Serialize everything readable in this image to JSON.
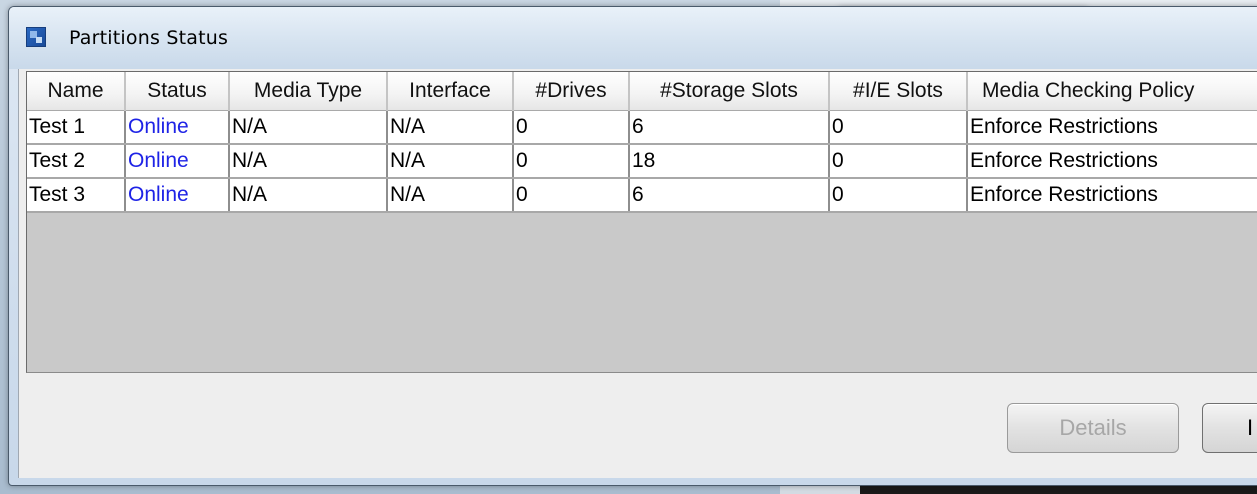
{
  "window": {
    "title": "Partitions Status"
  },
  "table": {
    "columns": [
      "Name",
      "Status",
      "Media Type",
      "Interface",
      "#Drives",
      "#Storage Slots",
      "#I/E Slots",
      "Media Checking Policy"
    ],
    "rows": [
      [
        "Test 1",
        "Online",
        "N/A",
        "N/A",
        "0",
        "6",
        "0",
        "Enforce Restrictions"
      ],
      [
        "Test 2",
        "Online",
        "N/A",
        "N/A",
        "0",
        "18",
        "0",
        "Enforce Restrictions"
      ],
      [
        "Test 3",
        "Online",
        "N/A",
        "N/A",
        "0",
        "6",
        "0",
        "Enforce Restrictions"
      ]
    ]
  },
  "buttons": {
    "details": "Details",
    "next_partial": "I"
  },
  "colors": {
    "status_online": "#1e23e6",
    "disabled_text": "#a7a7a7"
  },
  "icons": {
    "window_icon": "app-window-icon"
  }
}
